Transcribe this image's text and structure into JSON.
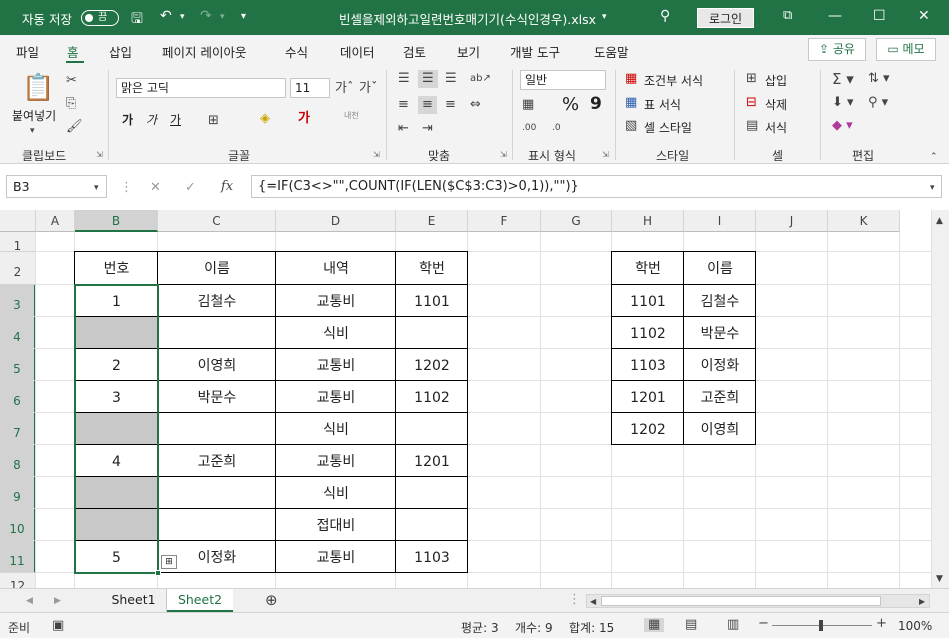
{
  "titlebar": {
    "autosave_label": "자동 저장",
    "autosave_state": "끔",
    "filename": "빈셀을제외하고일련번호매기기(수식인경우).xlsx",
    "login_label": "로그인"
  },
  "tabs": [
    "파일",
    "홈",
    "삽입",
    "페이지 레이아웃",
    "수식",
    "데이터",
    "검토",
    "보기",
    "개발 도구",
    "도움말"
  ],
  "active_tab": "홈",
  "share_label": "공유",
  "memo_label": "메모",
  "ribbon": {
    "clipboard": {
      "paste": "붙여넣기",
      "label": "클립보드"
    },
    "font": {
      "name": "맑은 고딕",
      "size": "11",
      "bold": "가",
      "italic": "가",
      "underline": "가",
      "label": "글꼴",
      "phonetic": "내천"
    },
    "alignment": {
      "label": "맞춤"
    },
    "number": {
      "format": "일반",
      "label": "표시 형식",
      "percent": "%",
      "comma": "9"
    },
    "styles": {
      "conditional": "조건부 서식",
      "table": "표 서식",
      "cell": "셀 스타일",
      "label": "스타일"
    },
    "cells": {
      "insert": "삽입",
      "delete": "삭제",
      "format": "서식",
      "label": "셀"
    },
    "editing": {
      "label": "편집"
    }
  },
  "formula_bar": {
    "name_box": "B3",
    "formula": "{=IF(C3<>\"\",COUNT(IF(LEN($C$3:C3)>0,1)),\"\")}"
  },
  "columns": [
    "A",
    "B",
    "C",
    "D",
    "E",
    "F",
    "G",
    "H",
    "I",
    "J",
    "K"
  ],
  "rows": [
    "1",
    "2",
    "3",
    "4",
    "5",
    "6",
    "7",
    "8",
    "9",
    "10",
    "11",
    "12"
  ],
  "selected_col": "B",
  "selected_rows": [
    "3",
    "4",
    "5",
    "6",
    "7",
    "8",
    "9",
    "10",
    "11"
  ],
  "table1": {
    "headers": [
      "번호",
      "이름",
      "내역",
      "학번"
    ],
    "rows": [
      [
        "1",
        "김철수",
        "교통비",
        "1101"
      ],
      [
        "",
        "",
        "식비",
        ""
      ],
      [
        "2",
        "이영희",
        "교통비",
        "1202"
      ],
      [
        "3",
        "박문수",
        "교통비",
        "1102"
      ],
      [
        "",
        "",
        "식비",
        ""
      ],
      [
        "4",
        "고준희",
        "교통비",
        "1201"
      ],
      [
        "",
        "",
        "식비",
        ""
      ],
      [
        "",
        "",
        "접대비",
        ""
      ],
      [
        "5",
        "이정화",
        "교통비",
        "1103"
      ]
    ]
  },
  "table2": {
    "headers": [
      "학번",
      "이름"
    ],
    "rows": [
      [
        "1101",
        "김철수"
      ],
      [
        "1102",
        "박문수"
      ],
      [
        "1103",
        "이정화"
      ],
      [
        "1201",
        "고준희"
      ],
      [
        "1202",
        "이영희"
      ]
    ]
  },
  "sheets": [
    "Sheet1",
    "Sheet2"
  ],
  "active_sheet": "Sheet2",
  "status": {
    "mode": "준비",
    "average": "평균: 3",
    "count": "개수: 9",
    "sum": "합계: 15",
    "zoom": "100%"
  }
}
